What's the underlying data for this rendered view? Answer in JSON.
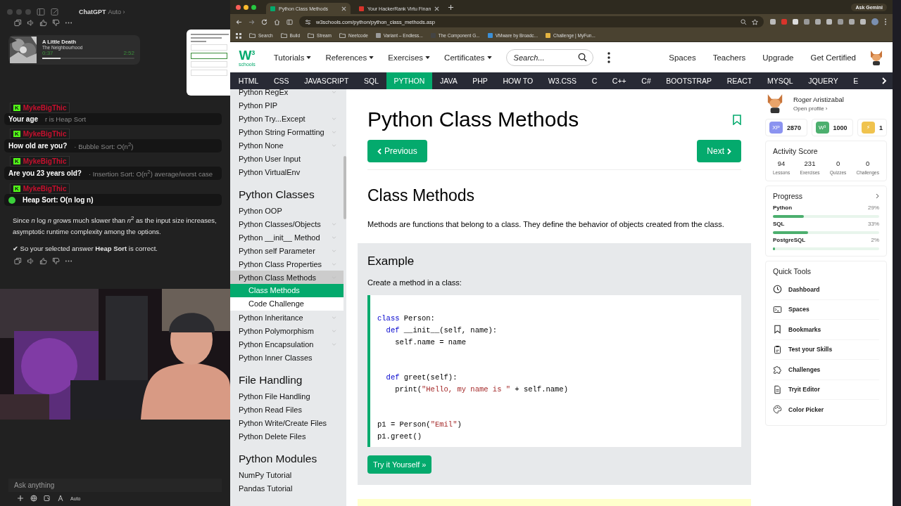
{
  "chat_app": {
    "title": "ChatGPT",
    "model": "Auto ›",
    "media": {
      "title": "A Little Death",
      "artist": "The Neighbourhood",
      "elapsed": "0:37",
      "duration": "2:52",
      "level": 0.2
    },
    "overlay_messages": [
      {
        "mark": "K",
        "name": "MykeBigThic",
        "text": "Your age",
        "behind": "r is Heap Sort"
      },
      {
        "mark": "K",
        "name": "MykeBigThic",
        "text": "How old are you?",
        "behind": "· Bubble Sort: O(n$^{2}$)"
      },
      {
        "mark": "K",
        "name": "MykeBigThic",
        "text": "Are you 23 years old?",
        "behind": "· Insertion Sort: O(n$^{2}$) average/worst case"
      },
      {
        "mark": "K",
        "name": "MykeBigThic",
        "text": "Heap Sort: O(n log n)"
      }
    ],
    "answer": "Since *n* log *n* grows much slower than *n*$^{2}$ as the input size increases, asymptotic runtime complexity among the options.",
    "verdict": "✔ So your selected answer **Heap Sort** is correct.",
    "input": {
      "placeholder": "Ask anything",
      "mode": "Auto"
    }
  },
  "browser": {
    "tabs": [
      {
        "title": "Python Class Methods",
        "selected": true,
        "color": "#04aa6d"
      },
      {
        "title": "Your HackerRank Virtu Finan",
        "selected": false,
        "color": "#d9342b"
      }
    ],
    "gemini": "Ask Gemini",
    "url": "w3schools.com/python/python_class_methods.asp",
    "bookmarks": [
      {
        "kind": "folder",
        "label": "Search"
      },
      {
        "kind": "folder",
        "label": "Build"
      },
      {
        "kind": "folder",
        "label": "Stream"
      },
      {
        "kind": "folder",
        "label": "Neetcode"
      },
      {
        "kind": "site",
        "label": "Variant – Endless...",
        "color": "#9a9a9a"
      },
      {
        "kind": "site",
        "label": "The Component G...",
        "color": "#444444"
      },
      {
        "kind": "site",
        "label": "VMware by Broadc...",
        "color": "#3b8fd6"
      },
      {
        "kind": "site",
        "label": "Challenge | MyFun...",
        "color": "#e3b341"
      }
    ]
  },
  "site": {
    "logo": {
      "mark": "W",
      "sup": "3",
      "word": "schools"
    },
    "menus": [
      "Tutorials",
      "References",
      "Exercises",
      "Certificates"
    ],
    "search": {
      "placeholder": "Search..."
    },
    "links": [
      "Spaces",
      "Teachers",
      "Upgrade",
      "Get Certified"
    ],
    "topics": [
      {
        "label": "HTML",
        "selected": false
      },
      {
        "label": "CSS",
        "selected": false
      },
      {
        "label": "JAVASCRIPT",
        "selected": false
      },
      {
        "label": "SQL",
        "selected": false
      },
      {
        "label": "PYTHON",
        "selected": true
      },
      {
        "label": "JAVA",
        "selected": false
      },
      {
        "label": "PHP",
        "selected": false
      },
      {
        "label": "HOW TO",
        "selected": false
      },
      {
        "label": "W3.CSS",
        "selected": false
      },
      {
        "label": "C",
        "selected": false
      },
      {
        "label": "C++",
        "selected": false
      },
      {
        "label": "C#",
        "selected": false
      },
      {
        "label": "BOOTSTRAP",
        "selected": false
      },
      {
        "label": "REACT",
        "selected": false
      },
      {
        "label": "MYSQL",
        "selected": false
      },
      {
        "label": "JQUERY",
        "selected": false
      },
      {
        "label": "E",
        "selected": false
      }
    ],
    "sidebar": [
      {
        "kind": "item",
        "label": "Python RegEx",
        "expandable": true,
        "expanded": false
      },
      {
        "kind": "item",
        "label": "Python PIP",
        "expandable": false,
        "expanded": false
      },
      {
        "kind": "item",
        "label": "Python Try...Except",
        "expandable": true,
        "expanded": false
      },
      {
        "kind": "item",
        "label": "Python String Formatting",
        "expandable": true,
        "expanded": false
      },
      {
        "kind": "item",
        "label": "Python None",
        "expandable": true,
        "expanded": false
      },
      {
        "kind": "item",
        "label": "Python User Input",
        "expandable": false,
        "expanded": false
      },
      {
        "kind": "item",
        "label": "Python VirtualEnv",
        "expandable": false,
        "expanded": false
      },
      {
        "kind": "heading",
        "label": "Python Classes"
      },
      {
        "kind": "item",
        "label": "Python OOP",
        "expandable": false,
        "expanded": false
      },
      {
        "kind": "item",
        "label": "Python Classes/Objects",
        "expandable": true,
        "expanded": false
      },
      {
        "kind": "item",
        "label": "Python __init__ Method",
        "expandable": true,
        "expanded": false
      },
      {
        "kind": "item",
        "label": "Python self Parameter",
        "expandable": true,
        "expanded": false
      },
      {
        "kind": "item",
        "label": "Python Class Properties",
        "expandable": true,
        "expanded": false
      },
      {
        "kind": "item",
        "label": "Python Class Methods",
        "expandable": true,
        "expanded": true,
        "children": [
          {
            "label": "Class Methods",
            "selected": true
          },
          {
            "label": "Code Challenge",
            "selected": false
          }
        ]
      },
      {
        "kind": "item",
        "label": "Python Inheritance",
        "expandable": true,
        "expanded": false
      },
      {
        "kind": "item",
        "label": "Python Polymorphism",
        "expandable": true,
        "expanded": false
      },
      {
        "kind": "item",
        "label": "Python Encapsulation",
        "expandable": true,
        "expanded": false
      },
      {
        "kind": "item",
        "label": "Python Inner Classes",
        "expandable": false,
        "expanded": false
      },
      {
        "kind": "heading",
        "label": "File Handling"
      },
      {
        "kind": "item",
        "label": "Python File Handling",
        "expandable": false,
        "expanded": false
      },
      {
        "kind": "item",
        "label": "Python Read Files",
        "expandable": false,
        "expanded": false
      },
      {
        "kind": "item",
        "label": "Python Write/Create Files",
        "expandable": false,
        "expanded": false
      },
      {
        "kind": "item",
        "label": "Python Delete Files",
        "expandable": false,
        "expanded": false
      },
      {
        "kind": "heading",
        "label": "Python Modules"
      },
      {
        "kind": "item",
        "label": "NumPy Tutorial",
        "expandable": false,
        "expanded": false
      },
      {
        "kind": "item",
        "label": "Pandas Tutorial",
        "expandable": false,
        "expanded": false
      }
    ],
    "article": {
      "title": "Python Class Methods",
      "previous": "Previous",
      "next": "Next",
      "heading": "Class Methods",
      "intro": "Methods are functions that belong to a class. They define the behavior of objects created from the class.",
      "example": {
        "title": "Example",
        "caption": "Create a method in a class:",
        "code": [
          [
            [
              {
                "kind": "keyword",
                "text": "class"
              },
              {
                "kind": "plain",
                "text": " Person:"
              }
            ],
            [
              {
                "kind": "keyword",
                "text": "  def"
              },
              {
                "kind": "plain",
                "text": " __init__(self, name):"
              }
            ],
            [
              {
                "kind": "plain",
                "text": "    self.name = name"
              }
            ]
          ],
          [
            [
              {
                "kind": "keyword",
                "text": "  def"
              },
              {
                "kind": "plain",
                "text": " greet(self):"
              }
            ],
            [
              {
                "kind": "plain",
                "text": "    print("
              },
              {
                "kind": "string",
                "text": "\"Hello, my name is \""
              },
              {
                "kind": "plain",
                "text": " + self.name)"
              }
            ]
          ],
          [
            [
              {
                "kind": "plain",
                "text": "p1 = Person("
              },
              {
                "kind": "string",
                "text": "\"Emil\""
              },
              {
                "kind": "plain",
                "text": ")"
              }
            ],
            [
              {
                "kind": "plain",
                "text": "p1.greet()"
              }
            ]
          ]
        ],
        "button": "Try it Yourself »"
      }
    },
    "profile": {
      "name": "Roger Aristizabal",
      "link": "Open profile ›",
      "stats": [
        {
          "badge": "XP",
          "value": "2870",
          "color": "#8b93f0"
        },
        {
          "badge": "W³",
          "value": "1000",
          "color": "#4caf6e"
        },
        {
          "badge": "⚡",
          "value": "1",
          "color": "#f0c34e"
        }
      ],
      "activity": {
        "title": "Activity Score",
        "items": [
          {
            "value": "94",
            "label": "Lessons"
          },
          {
            "value": "231",
            "label": "Exercises"
          },
          {
            "value": "0",
            "label": "Quizzes"
          },
          {
            "value": "0",
            "label": "Challenges"
          }
        ]
      },
      "progress": {
        "title": "Progress",
        "items": [
          {
            "label": "Python",
            "reading": "29%",
            "level": 0.29
          },
          {
            "label": "SQL",
            "reading": "33%",
            "level": 0.33
          },
          {
            "label": "PostgreSQL",
            "reading": "2%",
            "level": 0.02
          }
        ]
      },
      "tools": {
        "title": "Quick Tools",
        "items": [
          {
            "kind": "clock",
            "label": "Dashboard"
          },
          {
            "kind": "terminal",
            "label": "Spaces"
          },
          {
            "kind": "bookmark",
            "label": "Bookmarks"
          },
          {
            "kind": "clipboard",
            "label": "Test your Skills"
          },
          {
            "kind": "puzzle",
            "label": "Challenges"
          },
          {
            "kind": "document",
            "label": "Tryit Editor"
          },
          {
            "kind": "palette",
            "label": "Color Picker"
          }
        ]
      }
    }
  }
}
